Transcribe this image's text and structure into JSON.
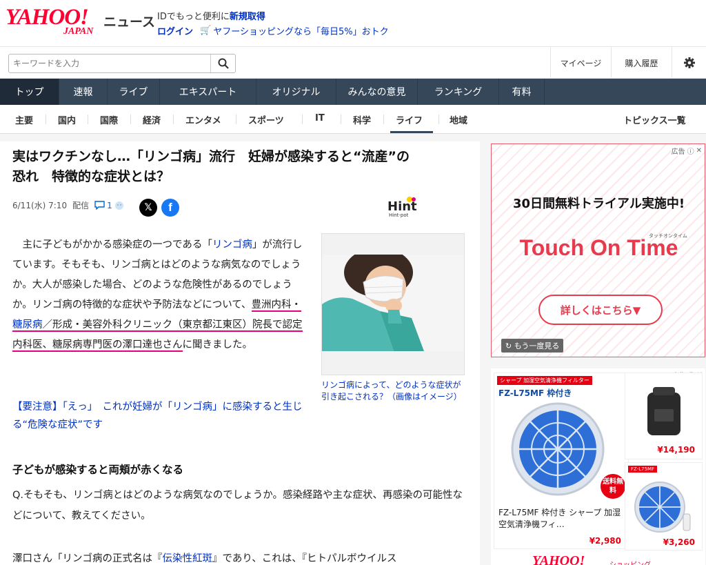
{
  "header": {
    "logo_main": "YAHOO!",
    "logo_sub": "JAPAN",
    "service": "ニュース",
    "promo_prefix": "IDでもっと便利に",
    "promo_link": "新規取得",
    "login": "ログイン",
    "shopping_link": "ヤフーショッピングなら「毎日5%」おトク"
  },
  "search": {
    "placeholder": "キーワードを入力"
  },
  "utility": {
    "mypage": "マイページ",
    "purchase_history": "購入履歴"
  },
  "nav": {
    "items": [
      {
        "label": "トップ"
      },
      {
        "label": "速報"
      },
      {
        "label": "ライブ"
      },
      {
        "label": "エキスパート"
      },
      {
        "label": "オリジナル"
      },
      {
        "label": "みんなの意見"
      },
      {
        "label": "ランキング"
      },
      {
        "label": "有料"
      }
    ]
  },
  "subnav": {
    "items": [
      {
        "label": "主要"
      },
      {
        "label": "国内"
      },
      {
        "label": "国際"
      },
      {
        "label": "経済"
      },
      {
        "label": "エンタメ"
      },
      {
        "label": "スポーツ"
      },
      {
        "label": "IT"
      },
      {
        "label": "科学"
      },
      {
        "label": "ライフ"
      },
      {
        "label": "地域"
      }
    ],
    "active": "ライフ",
    "topics_all": "トピックス一覧"
  },
  "article": {
    "title_line1": "実はワクチンなし…「リンゴ病」流行　妊婦が感染すると“流産”の",
    "title_line2": "恐れ　特徴的な症状とは？",
    "date": "6/11(水) 7:10",
    "delivery": "配信",
    "comment_count": "1",
    "media_logo": "Hint-pot",
    "media_logo_sub": "Hint-pot",
    "p1_a": "　主に子どもがかかる感染症の一つである「",
    "p1_link": "リンゴ病",
    "p1_b": "」が流行しています。そもそも、リンゴ病とはどのような病気なのでしょうか。大人が感染した場合、どのような危険性があるのでしょうか。リンゴ病の特徴的な症状や予防法などについて、",
    "p1_c": "豊洲内科・",
    "p1_link2": "糖尿病",
    "p1_d": "／形成・美容外科クリニック（東京都江東区）院長で認定内科医、糖尿病専門医の澤口達也さん",
    "p1_e": "に聞きました。",
    "caption": "リンゴ病によって、どのような症状が引き起こされる？（画像はイメージ）",
    "related": "【要注意】「えっ」　これが妊婦が「リンゴ病」に感染すると生じる“危険な症状”です",
    "heading": "子どもが感染すると両頬が赤くなる",
    "q": "Q.そもそも、リンゴ病とはどのような病気なのでしょうか。感染経路や主な症状、再感染の可能性などについて、教えてください。",
    "a_prefix": "澤口さん「リンゴ病の正式名は『",
    "a_link": "伝染性紅斑",
    "a_suffix": "』であり、これは、『ヒトパルボウイルス"
  },
  "ad1": {
    "label": "広告",
    "headline": "30日間無料トライアル実施中!",
    "brand": "Touch On Time",
    "brand_small": "タッチオンタイム",
    "cta": "詳しくはこちら▼",
    "replay": "もう一度見る"
  },
  "ad2": {
    "label": "広告",
    "tag": "シャープ 加湿空気清浄機フィルター",
    "model": "FZ-L75MF 枠付き",
    "free_shipping": "送料無料",
    "product1_name": "FZ-L75MF 枠付き シャープ 加湿空気清浄機フィ…",
    "product1_price": "¥2,980",
    "product2_price": "¥14,190",
    "product3_price": "¥3,260",
    "product3_model": "FZ-L75MF",
    "footer_logo": "YAHOO!",
    "footer_sub": "ショッピング"
  },
  "colors": {
    "brand_red": "#ff0033",
    "nav_bg": "#37475a",
    "link_blue": "#0030c0",
    "highlight_pink": "#e6007e",
    "ad_accent": "#e83a4c"
  }
}
